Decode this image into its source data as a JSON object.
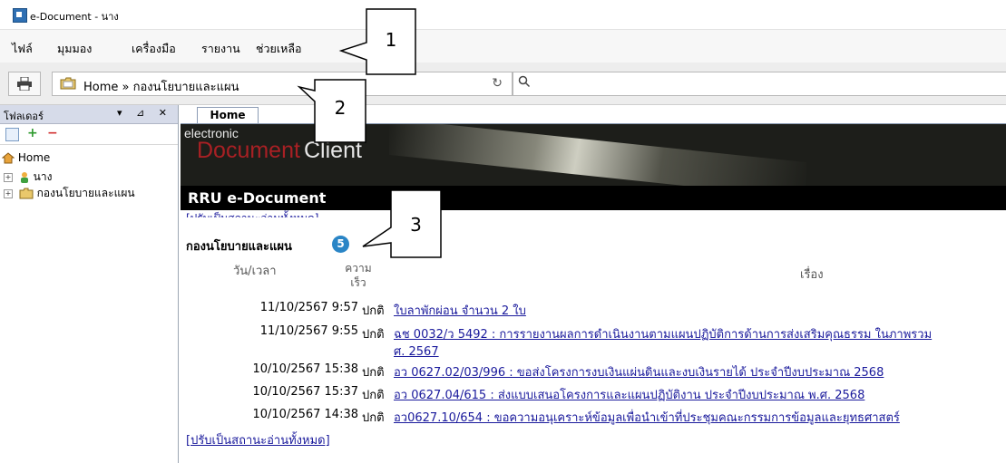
{
  "window": {
    "title": "e-Document - นาง"
  },
  "menu": {
    "items": [
      "ไฟล์",
      "มุมมอง",
      "เครื่องมือ",
      "รายงาน",
      "ช่วยเหลือ"
    ]
  },
  "toolbar": {
    "address": "Home » กองนโยบายและแผน",
    "search_placeholder": ""
  },
  "sidebar": {
    "title": "โฟลเดอร์",
    "controls": "▾ ⊿ ✕",
    "tree": [
      {
        "label": "Home",
        "icon": "home-icon"
      },
      {
        "label": "นาง",
        "icon": "user-icon"
      },
      {
        "label": "กองนโยบายและแผน",
        "icon": "folder-icon"
      }
    ]
  },
  "tabs": [
    {
      "label": "Home"
    }
  ],
  "banner": {
    "small": "electronic",
    "doc": "Document",
    "client": "Client",
    "brand": "RRU e-Document"
  },
  "inbox": {
    "hidden_link": "[ปรับเป็นสถานะอ่านทั้งหมด]",
    "title": "กองนโยบายและแผน",
    "count": "5",
    "columns": {
      "date": "วัน/เวลา",
      "speed_1": "ความ",
      "speed_2": "เร็ว",
      "subject": "เรื่อง"
    },
    "rows": [
      {
        "date": "11/10/2567 9:57",
        "speed": "ปกติ",
        "subject": "ใบลาพักผ่อน จำนวน 2 ใบ"
      },
      {
        "date": "11/10/2567 9:55",
        "speed": "ปกติ",
        "subject": "ฉช 0032/ว 5492 : การรายงานผลการดำเนินงานตามแผนปฏิบัติการด้านการส่งเสริมคุณธรรม ในภาพรวม",
        "subject_2": "ศ. 2567"
      },
      {
        "date": "10/10/2567 15:38",
        "speed": "ปกติ",
        "subject": "อว 0627.02/03/996 : ขอส่งโครงการงบเงินแผ่นดินและงบเงินรายได้ ประจำปีงบประมาณ 2568"
      },
      {
        "date": "10/10/2567 15:37",
        "speed": "ปกติ",
        "subject": "อว 0627.04/615 : ส่งแบบเสนอโครงการและแผนปฏิบัติงาน ประจำปีงบประมาณ พ.ศ. 2568"
      },
      {
        "date": "10/10/2567 14:38",
        "speed": "ปกติ",
        "subject": "อว0627.10/654 : ขอความอนุเคราะห์ข้อมูลเพื่อนำเข้าที่ประชุมคณะกรรมการข้อมูลและยุทธศาสตร์"
      }
    ],
    "read_all": "[ปรับเป็นสถานะอ่านทั้งหมด]"
  },
  "callouts": [
    "1",
    "2",
    "3"
  ]
}
